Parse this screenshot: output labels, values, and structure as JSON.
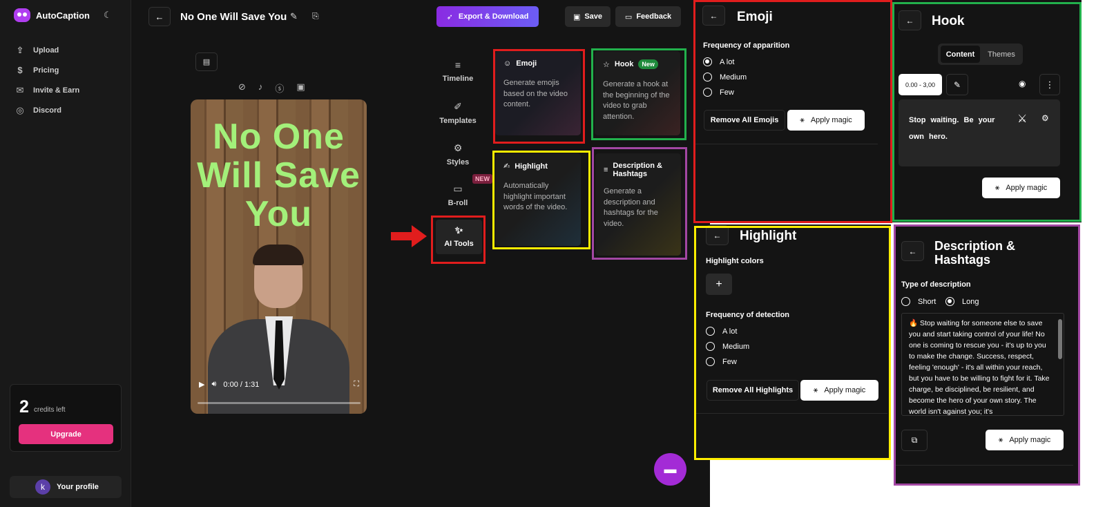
{
  "app": {
    "brand": "AutoCaption",
    "nav": [
      {
        "icon": "upload-icon",
        "glyph": "⇪",
        "label": "Upload"
      },
      {
        "icon": "dollar-icon",
        "glyph": "$",
        "label": "Pricing"
      },
      {
        "icon": "gift-icon",
        "glyph": "✉",
        "label": "Invite & Earn"
      },
      {
        "icon": "discord-icon",
        "glyph": "◎",
        "label": "Discord"
      }
    ],
    "credits": {
      "count": "2",
      "label": "credits left",
      "upgrade": "Upgrade"
    },
    "profile": {
      "initial": "k",
      "label": "Your profile"
    }
  },
  "topbar": {
    "title": "No One Will Save You",
    "export_label": "Export & Download",
    "save_label": "Save",
    "feedback_label": "Feedback"
  },
  "video": {
    "caption": "No One Will Save You",
    "time": "0:00 / 1:31"
  },
  "rail": {
    "timeline": "Timeline",
    "templates": "Templates",
    "styles": "Styles",
    "broll": "B-roll",
    "new_badge": "NEW",
    "ai_tools": "AI Tools"
  },
  "cards": {
    "emoji": {
      "title": "Emoji",
      "desc": "Generate emojis based on the video content."
    },
    "hook": {
      "title": "Hook",
      "badge": "New",
      "desc": "Generate a hook at the beginning of the video to grab attention."
    },
    "highlight": {
      "title": "Highlight",
      "desc": "Automatically highlight important words of the video."
    },
    "description": {
      "title": "Description & Hashtags",
      "desc": "Generate a description and hashtags for the video."
    }
  },
  "emoji_panel": {
    "title": "Emoji",
    "freq_label": "Frequency of apparition",
    "options": [
      "A lot",
      "Medium",
      "Few"
    ],
    "selected": "A lot",
    "remove_label": "Remove All Emojis",
    "apply_label": "Apply magic"
  },
  "hook_panel": {
    "title": "Hook",
    "tabs": [
      "Content",
      "Themes"
    ],
    "range": "0.00 - 3,00",
    "text": "Stop waiting. Be your own hero.",
    "apply_label": "Apply magic"
  },
  "highlight_panel": {
    "title": "Highlight",
    "colors_label": "Highlight colors",
    "freq_label": "Frequency of detection",
    "options": [
      "A lot",
      "Medium",
      "Few"
    ],
    "remove_label": "Remove All Highlights",
    "apply_label": "Apply magic"
  },
  "description_panel": {
    "title": "Description & Hashtags",
    "type_label": "Type of description",
    "options": [
      "Short",
      "Long"
    ],
    "selected": "Long",
    "text": "🔥 Stop waiting for someone else to save you and start taking control of your life! No one is coming to rescue you - it's up to you to make the change. Success, respect, feeling 'enough' - it's all within your reach, but you have to be willing to fight for it. Take charge, be disciplined, be resilient, and become the hero of your own story. The world isn't against you; it's",
    "apply_label": "Apply magic"
  },
  "colors": {
    "red": "#e11d1d",
    "green": "#22b14c",
    "yellow": "#ffee00",
    "purple": "#a347a3",
    "accent": "#8a2be2",
    "upgrade": "#e5317e"
  }
}
